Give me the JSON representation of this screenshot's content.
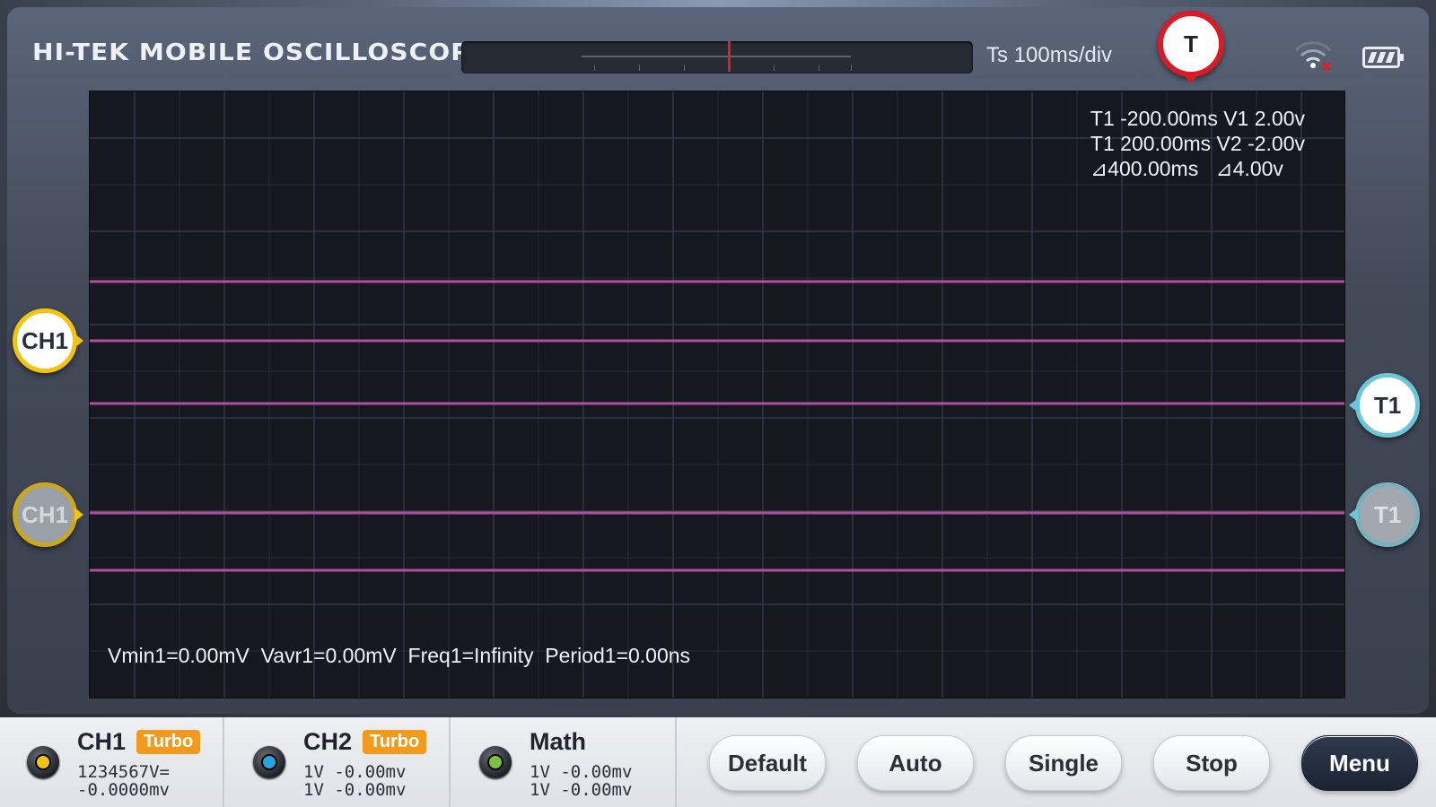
{
  "header": {
    "title": "HI-TEK MOBILE OSCILLOSCOPE",
    "timebase": "Ts 100ms/div",
    "trigger_label": "T"
  },
  "measurements": {
    "line1": "T1 -200.00ms V1 2.00v",
    "line2": "T1 200.00ms V2 -2.00v",
    "line3": "⊿400.00ms   ⊿4.00v"
  },
  "stats": "Vmin1=0.00mV  Vavr1=0.00mV  Freq1=Infinity  Period1=0.00ns",
  "markers": {
    "ch1_active": "CH1",
    "ch1_ghost": "CH1",
    "t1_active": "T1",
    "t1_ghost": "T1"
  },
  "channels": [
    {
      "name": "CH1",
      "badge": "Turbo",
      "line1": "1234567V=",
      "line2": "-0.0000mv",
      "color": "#f2c40f"
    },
    {
      "name": "CH2",
      "badge": "Turbo",
      "line1": "1V -0.00mv",
      "line2": "1V -0.00mv",
      "color": "#29a3dd"
    },
    {
      "name": "Math",
      "badge": "",
      "line1": "1V -0.00mv",
      "line2": "1V -0.00mv",
      "color": "#7cc23a"
    }
  ],
  "buttons": {
    "default": "Default",
    "auto": "Auto",
    "single": "Single",
    "stop": "Stop",
    "menu": "Menu"
  },
  "icons": {
    "wifi": "wifi-disconnected-icon",
    "battery": "battery-icon"
  },
  "colors": {
    "trace": "#b04fa0",
    "grid": "#2b3038",
    "trigger_red": "#d81b24",
    "ch1_yellow": "#f2c40f",
    "t1_cyan": "#6cc6da",
    "turbo_orange": "#f29a1e"
  }
}
